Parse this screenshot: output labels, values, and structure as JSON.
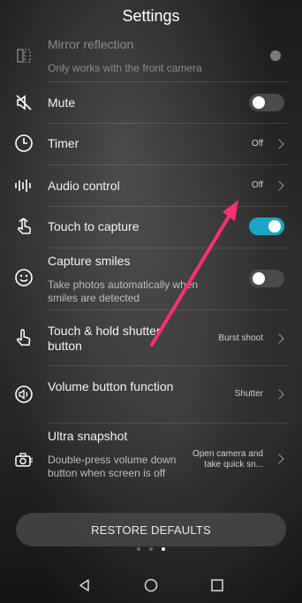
{
  "header": {
    "title": "Settings"
  },
  "items": [
    {
      "id": "mirror",
      "label": "Mirror reflection",
      "desc": "Only works with the front camera",
      "state": "disabled"
    },
    {
      "id": "mute",
      "label": "Mute",
      "toggle": false
    },
    {
      "id": "timer",
      "label": "Timer",
      "value": "Off"
    },
    {
      "id": "audio",
      "label": "Audio control",
      "value": "Off"
    },
    {
      "id": "touch",
      "label": "Touch to capture",
      "toggle": true
    },
    {
      "id": "smiles",
      "label": "Capture smiles",
      "desc": "Take photos automatically when smiles are detected",
      "toggle": false
    },
    {
      "id": "hold",
      "label": "Touch & hold shutter button",
      "value": "Burst shoot"
    },
    {
      "id": "volume",
      "label": "Volume button function",
      "value": "Shutter"
    },
    {
      "id": "ultra",
      "label": "Ultra snapshot",
      "desc": "Double-press volume down button when screen is off",
      "value": "Open camera and take quick sn..."
    }
  ],
  "restore_label": "RESTORE DEFAULTS",
  "page_indicator": {
    "count": 3,
    "active": 3
  },
  "colors": {
    "toggle_on": "#1aa7c5",
    "annotation_arrow": "#ff2d72"
  }
}
